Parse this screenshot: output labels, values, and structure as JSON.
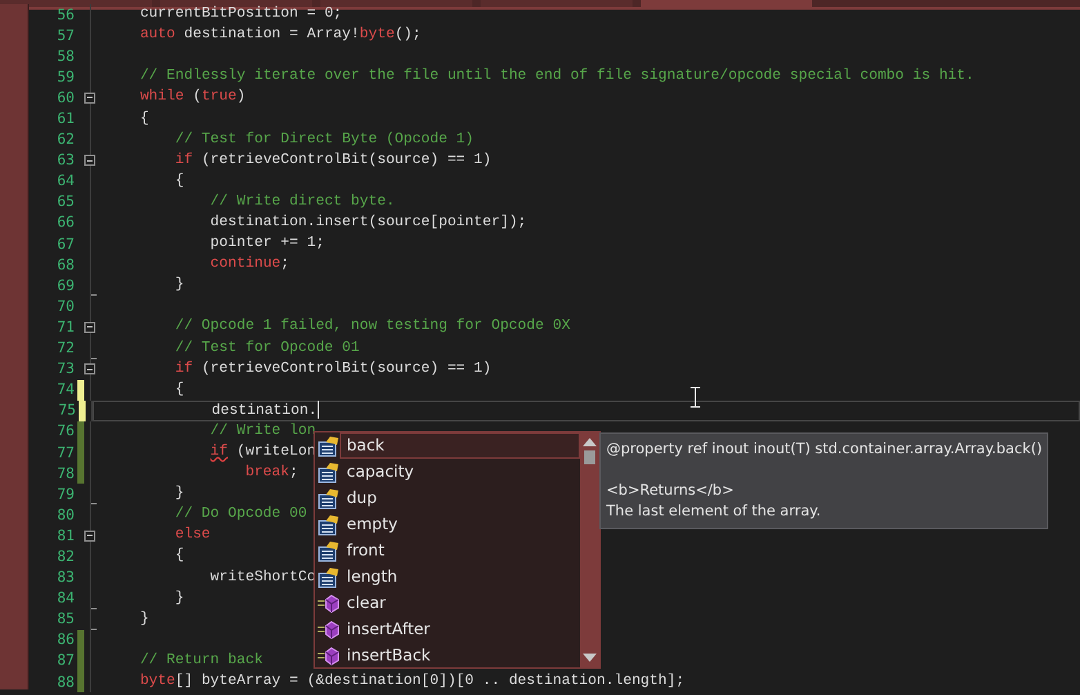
{
  "tabs": [
    {
      "selected": false
    },
    {
      "selected": false
    },
    {
      "selected": false
    },
    {
      "selected": false
    },
    {
      "selected": true
    }
  ],
  "lines": [
    {
      "number": "56",
      "collapsible": false,
      "block_end": false,
      "saved_change": false,
      "unsaved_change": false,
      "tokens": [
        {
          "kind": "text",
          "text": "    currentBitPosition = 0;"
        }
      ]
    },
    {
      "number": "57",
      "collapsible": false,
      "block_end": false,
      "saved_change": false,
      "unsaved_change": false,
      "tokens": [
        {
          "kind": "kw",
          "text": "    auto"
        },
        {
          "kind": "text",
          "text": " destination = Array!"
        },
        {
          "kind": "kw",
          "text": "byte"
        },
        {
          "kind": "text",
          "text": "();"
        }
      ]
    },
    {
      "number": "58",
      "collapsible": false,
      "block_end": false,
      "saved_change": false,
      "unsaved_change": false
    },
    {
      "number": "59",
      "collapsible": false,
      "block_end": false,
      "saved_change": false,
      "unsaved_change": false,
      "tokens": [
        {
          "kind": "comment",
          "text": "    // Endlessly iterate over the file until the end of file signature/opcode special combo is hit."
        }
      ]
    },
    {
      "number": "60",
      "collapsible": true,
      "block_end": false,
      "saved_change": false,
      "unsaved_change": false,
      "tokens": [
        {
          "kind": "kw",
          "text": "    while"
        },
        {
          "kind": "text",
          "text": " ("
        },
        {
          "kind": "kw",
          "text": "true"
        },
        {
          "kind": "text",
          "text": ")"
        }
      ]
    },
    {
      "number": "61",
      "collapsible": false,
      "block_end": false,
      "saved_change": false,
      "unsaved_change": false,
      "tokens": [
        {
          "kind": "text",
          "text": "    {"
        }
      ]
    },
    {
      "number": "62",
      "collapsible": false,
      "block_end": false,
      "saved_change": false,
      "unsaved_change": false,
      "tokens": [
        {
          "kind": "comment",
          "text": "        // Test for Direct Byte (Opcode 1)"
        }
      ]
    },
    {
      "number": "63",
      "collapsible": true,
      "block_end": false,
      "saved_change": false,
      "unsaved_change": false,
      "tokens": [
        {
          "kind": "kw",
          "text": "        if"
        },
        {
          "kind": "text",
          "text": " (retrieveControlBit(source) == 1)"
        }
      ]
    },
    {
      "number": "64",
      "collapsible": false,
      "block_end": false,
      "saved_change": false,
      "unsaved_change": false,
      "tokens": [
        {
          "kind": "text",
          "text": "        {"
        }
      ]
    },
    {
      "number": "65",
      "collapsible": false,
      "block_end": false,
      "saved_change": false,
      "unsaved_change": false,
      "tokens": [
        {
          "kind": "comment",
          "text": "            // Write direct byte."
        }
      ]
    },
    {
      "number": "66",
      "collapsible": false,
      "block_end": false,
      "saved_change": false,
      "unsaved_change": false,
      "tokens": [
        {
          "kind": "text",
          "text": "            destination.insert(source[pointer]);"
        }
      ]
    },
    {
      "number": "67",
      "collapsible": false,
      "block_end": false,
      "saved_change": false,
      "unsaved_change": false,
      "tokens": [
        {
          "kind": "text",
          "text": "            pointer += 1;"
        }
      ]
    },
    {
      "number": "68",
      "collapsible": false,
      "block_end": false,
      "saved_change": false,
      "unsaved_change": false,
      "tokens": [
        {
          "kind": "kw",
          "text": "            continue"
        },
        {
          "kind": "text",
          "text": ";"
        }
      ]
    },
    {
      "number": "69",
      "collapsible": false,
      "block_end": true,
      "saved_change": false,
      "unsaved_change": false,
      "tokens": [
        {
          "kind": "text",
          "text": "        }"
        }
      ]
    },
    {
      "number": "70",
      "collapsible": false,
      "block_end": false,
      "saved_change": false,
      "unsaved_change": false
    },
    {
      "number": "71",
      "collapsible": true,
      "block_end": false,
      "saved_change": false,
      "unsaved_change": false,
      "tokens": [
        {
          "kind": "comment",
          "text": "        // Opcode 1 failed, now testing for Opcode 0X"
        }
      ]
    },
    {
      "number": "72",
      "collapsible": false,
      "block_end": true,
      "saved_change": false,
      "unsaved_change": false,
      "tokens": [
        {
          "kind": "comment",
          "text": "        // Test for Opcode 01"
        }
      ]
    },
    {
      "number": "73",
      "collapsible": true,
      "block_end": false,
      "saved_change": false,
      "unsaved_change": false,
      "tokens": [
        {
          "kind": "kw",
          "text": "        if"
        },
        {
          "kind": "text",
          "text": " (retrieveControlBit(source) == 1)"
        }
      ]
    },
    {
      "number": "74",
      "collapsible": false,
      "block_end": false,
      "saved_change": false,
      "unsaved_change": true,
      "tokens": [
        {
          "kind": "text",
          "text": "        {"
        }
      ]
    },
    {
      "number": "75",
      "collapsible": false,
      "block_end": false,
      "saved_change": false,
      "unsaved_change": true,
      "current": true,
      "tokens": [
        {
          "kind": "text",
          "text": "            destination."
        }
      ]
    },
    {
      "number": "76",
      "collapsible": false,
      "block_end": false,
      "saved_change": true,
      "unsaved_change": false,
      "tokens": [
        {
          "kind": "comment",
          "text": "            // Write lon"
        }
      ]
    },
    {
      "number": "77",
      "collapsible": false,
      "block_end": false,
      "saved_change": true,
      "unsaved_change": false,
      "tokens": [
        {
          "kind": "kw",
          "text": "            if",
          "error": true
        },
        {
          "kind": "text",
          "text": " (writeLon"
        }
      ]
    },
    {
      "number": "78",
      "collapsible": false,
      "block_end": false,
      "saved_change": true,
      "unsaved_change": false,
      "tokens": [
        {
          "kind": "kw",
          "text": "                break"
        },
        {
          "kind": "text",
          "text": ";"
        }
      ]
    },
    {
      "number": "79",
      "collapsible": false,
      "block_end": true,
      "saved_change": false,
      "unsaved_change": false,
      "tokens": [
        {
          "kind": "text",
          "text": "        }"
        }
      ]
    },
    {
      "number": "80",
      "collapsible": false,
      "block_end": false,
      "saved_change": false,
      "unsaved_change": false,
      "tokens": [
        {
          "kind": "comment",
          "text": "        // Do Opcode 00"
        }
      ]
    },
    {
      "number": "81",
      "collapsible": true,
      "block_end": false,
      "saved_change": false,
      "unsaved_change": false,
      "tokens": [
        {
          "kind": "kw",
          "text": "        else"
        }
      ]
    },
    {
      "number": "82",
      "collapsible": false,
      "block_end": false,
      "saved_change": false,
      "unsaved_change": false,
      "tokens": [
        {
          "kind": "text",
          "text": "        {"
        }
      ]
    },
    {
      "number": "83",
      "collapsible": false,
      "block_end": false,
      "saved_change": false,
      "unsaved_change": false,
      "tokens": [
        {
          "kind": "text",
          "text": "            writeShortCo"
        }
      ]
    },
    {
      "number": "84",
      "collapsible": false,
      "block_end": true,
      "saved_change": false,
      "unsaved_change": false,
      "tokens": [
        {
          "kind": "text",
          "text": "        }"
        }
      ]
    },
    {
      "number": "85",
      "collapsible": false,
      "block_end": true,
      "saved_change": false,
      "unsaved_change": false,
      "tokens": [
        {
          "kind": "text",
          "text": "    }"
        }
      ]
    },
    {
      "number": "86",
      "collapsible": false,
      "block_end": false,
      "saved_change": true,
      "unsaved_change": false
    },
    {
      "number": "87",
      "collapsible": false,
      "block_end": false,
      "saved_change": true,
      "unsaved_change": false,
      "tokens": [
        {
          "kind": "comment",
          "text": "    // Return back"
        }
      ]
    },
    {
      "number": "88",
      "collapsible": false,
      "block_end": false,
      "saved_change": true,
      "unsaved_change": false,
      "tokens": [
        {
          "kind": "kw",
          "text": "    byte"
        },
        {
          "kind": "text",
          "text": "[] byteArray = (&destination[0])[0 .. destination.length];"
        }
      ]
    }
  ],
  "completion": {
    "items": [
      {
        "kind": "property",
        "label": "back",
        "selected": true
      },
      {
        "kind": "property",
        "label": "capacity",
        "selected": false
      },
      {
        "kind": "property",
        "label": "dup",
        "selected": false
      },
      {
        "kind": "property",
        "label": "empty",
        "selected": false
      },
      {
        "kind": "property",
        "label": "front",
        "selected": false
      },
      {
        "kind": "property",
        "label": "length",
        "selected": false
      },
      {
        "kind": "method",
        "label": "clear",
        "selected": false
      },
      {
        "kind": "method",
        "label": "insertAfter",
        "selected": false
      },
      {
        "kind": "method",
        "label": "insertBack",
        "selected": false
      }
    ]
  },
  "tooltip": {
    "signature": "@property ref inout inout(T) std.container.array.Array.back()",
    "heading": "<b>Returns</b>",
    "description": "The last element of the array."
  }
}
